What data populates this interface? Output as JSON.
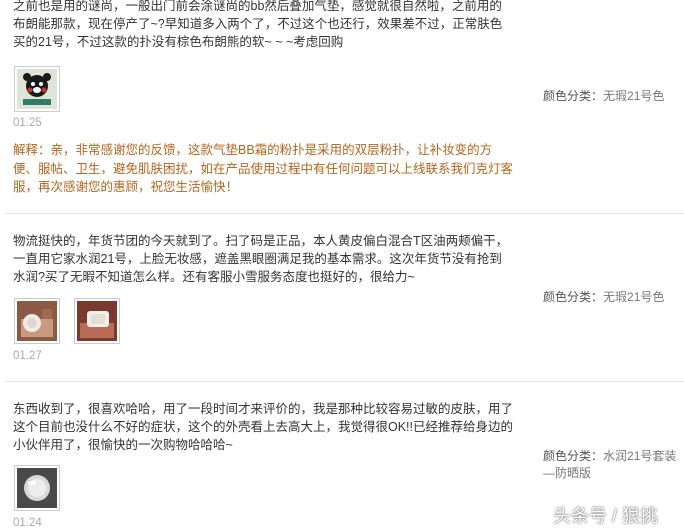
{
  "reviews": [
    {
      "text": "之前也是用的谜尚，一般出门前会涂谜尚的bb然后叠加气垫，感觉就很自然啦，之前用的布朗能那款，现在停产了~?早知道多入两个了，不过这个也还行，效果差不过，正常肤色买的21号，不过这款的扑没有棕色布朗熊的软~ ~ ~考虑回购",
      "date": "01.25",
      "reply": "解释：亲，非常感谢您的反馈，这款气垫BB霜的粉扑是采用的双层粉扑，让补妆变的方便、服帖、卫生，避免肌肤困扰，如在产品使用过程中有任何问题可以上线联系我们克灯客服，再次感谢您的惠顾，祝您生活愉快！",
      "sku_label": "颜色分类：",
      "sku_value": "无瑕21号色",
      "images": [
        "bear-photo"
      ]
    },
    {
      "text": "物流挺快的，年货节团的今天就到了。扫了码是正品，本人黄皮偏白混合T区油两颊偏干，一直用它家水润21号，上脸无妆感，遮盖黑眼圈满足我的基本需求。这次年货节没有抢到水润?买了无暇不知道怎么样。还有客服小雪服务态度也挺好的，很给力~",
      "date": "01.27",
      "sku_label": "颜色分类：",
      "sku_value": "无瑕21号色",
      "images": [
        "product-photo",
        "cushion-open-photo"
      ]
    },
    {
      "text": "东西收到了，很喜欢哈哈，用了一段时间才来评价的，我是那种比较容易过敏的皮肤，用了这个目前也没什么不好的症状，这个的外壳看上去高大上，我觉得很OK!!已经推荐给身边的小伙伴用了，很愉快的一次购物哈哈哈~",
      "date": "01.24",
      "sku_label": "颜色分类：",
      "sku_value": "水润21号套装—防晒版",
      "images": [
        "cushion-photo"
      ]
    }
  ],
  "watermark": "头条号 / 狠挑"
}
